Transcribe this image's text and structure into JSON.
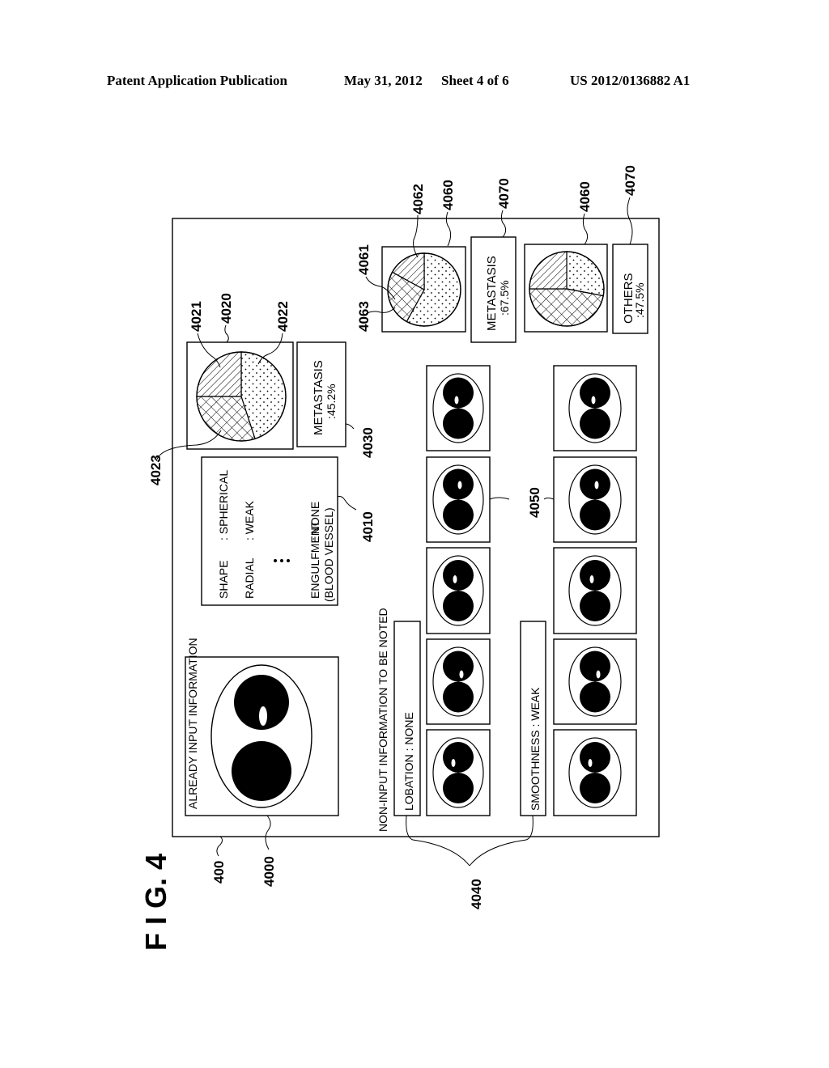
{
  "header": {
    "left": "Patent Application Publication",
    "date": "May 31, 2012",
    "sheet": "Sheet 4 of 6",
    "number": "US 2012/0136882 A1"
  },
  "figure": {
    "label": "F I G.  4",
    "refs": {
      "frame": "400",
      "main_image": "4000",
      "input_info": "4010",
      "pie_main": "4020",
      "pie_seg_hatched": "4021",
      "pie_seg_dotted": "4022",
      "pie_seg_crosshatched": "4023",
      "diagnosis_main": "4030",
      "non_input_labels": "4040",
      "similar_images": "4050",
      "pie_sub": "4060",
      "pie_sub_seg_hatched": "4061",
      "pie_sub_seg_dotted": "4062",
      "pie_sub_seg_crosshatched": "4063",
      "diagnosis_sub": "4070"
    },
    "input_info": {
      "title": "ALREADY INPUT INFORMATION",
      "rows": [
        {
          "key": "SHAPE",
          "value": ": SPHERICAL"
        },
        {
          "key": "RADIAL",
          "value": ": WEAK"
        },
        {
          "key": "ENGULFMENT",
          "key2": "(BLOOD VESSEL)",
          "value": ": NONE"
        }
      ],
      "ellipsis": "⋮"
    },
    "diagnosis_main": {
      "name": "METASTASIS",
      "value": ":45.2%"
    },
    "non_input": {
      "title": "NON-INPUT INFORMATION TO BE NOTED",
      "items": [
        "LOBATION : NONE",
        "SMOOTHNESS : WEAK"
      ]
    },
    "sub_results": [
      {
        "name": "METASTASIS",
        "value": ":67.5%"
      },
      {
        "name": "OTHERS",
        "value": ":47.5%"
      }
    ]
  },
  "chart_data": [
    {
      "type": "pie",
      "title": "4020",
      "slices": [
        {
          "name": "4022 (dotted)",
          "pattern": "dots",
          "value": 45
        },
        {
          "name": "4023 (cross-hatched)",
          "pattern": "crosshatch",
          "value": 30
        },
        {
          "name": "4021 (hatched)",
          "pattern": "diagonal",
          "value": 25
        }
      ]
    },
    {
      "type": "pie",
      "title": "4060 (METASTASIS)",
      "slices": [
        {
          "name": "4062 (dotted)",
          "pattern": "dots",
          "value": 58
        },
        {
          "name": "4063 (cross-hatched)",
          "pattern": "crosshatch",
          "value": 25
        },
        {
          "name": "4061 (hatched)",
          "pattern": "diagonal",
          "value": 17
        }
      ]
    },
    {
      "type": "pie",
      "title": "4060 (OTHERS)",
      "slices": [
        {
          "name": "dotted",
          "pattern": "dots",
          "value": 28
        },
        {
          "name": "cross-hatched",
          "pattern": "crosshatch",
          "value": 47
        },
        {
          "name": "hatched",
          "pattern": "diagonal",
          "value": 25
        }
      ]
    }
  ],
  "thumbnails": {
    "rows": 2,
    "cols": 5
  }
}
